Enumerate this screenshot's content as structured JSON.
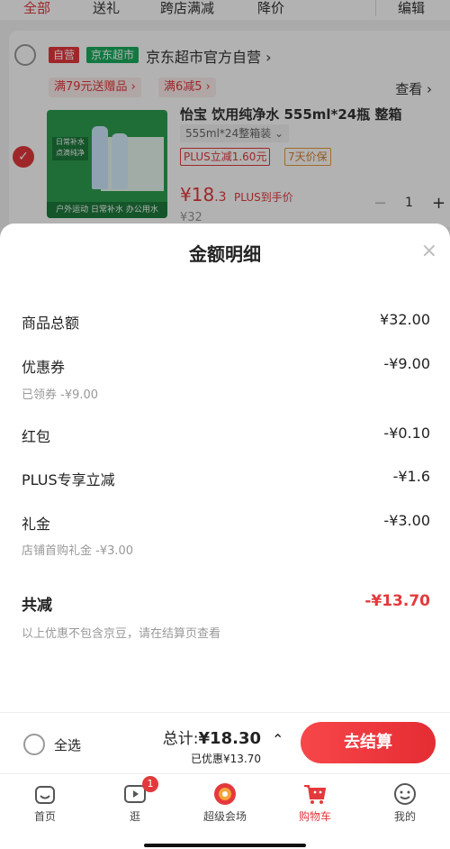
{
  "tabs": {
    "all": "全部",
    "gift": "送礼",
    "cross_store": "跨店满减",
    "price_drop": "降价",
    "edit": "编辑"
  },
  "store": {
    "self_badge": "自营",
    "market_badge": "京东超市",
    "name": "京东超市官方自营 ›",
    "promo1": "满79元送赠品 ›",
    "promo2": "满6减5 ›",
    "look": "查看 ›"
  },
  "product": {
    "title": "怡宝 饮用纯净水 555ml*24瓶 整箱",
    "spec": "555ml*24整箱装 ⌄",
    "image_label": "日常补水 点滴纯净",
    "image_strip": "户外运动 日常补水 办公用水",
    "tag_plus": "PLUS立减1.60元",
    "tag_price": "7天价保",
    "price_int": "¥18",
    "price_dec": ".3",
    "price_note": "PLUS到手价",
    "old_price": "¥32",
    "qty": "1",
    "plus": "+",
    "minus": "−"
  },
  "sheet": {
    "title": "金额明细",
    "close": "×",
    "rows": {
      "goods_total": {
        "label": "商品总额",
        "value": "¥32.00"
      },
      "coupon": {
        "label": "优惠券",
        "value": "-¥9.00",
        "sub": "已领券 -¥9.00"
      },
      "red_packet": {
        "label": "红包",
        "value": "-¥0.10"
      },
      "plus_discount": {
        "label": "PLUS专享立减",
        "value": "-¥1.6"
      },
      "gift_money": {
        "label": "礼金",
        "value": "-¥3.00",
        "sub": "店铺首购礼金 -¥3.00"
      },
      "total_reduction": {
        "label": "共减",
        "value": "-¥13.70"
      }
    },
    "note": "以上优惠不包含京豆，请在结算页查看"
  },
  "action_bar": {
    "select_all": "全选",
    "total_label": "总计:",
    "total_value": "¥18.30",
    "saved": "已优惠¥13.70",
    "chevron": "⌃",
    "checkout": "去结算"
  },
  "tabbar": {
    "home": "首页",
    "browse": "逛",
    "browse_badge": "1",
    "super": "超级会场",
    "cart": "购物车",
    "me": "我的"
  },
  "colors": {
    "accent": "#e4393c",
    "green": "#1aad5e"
  }
}
